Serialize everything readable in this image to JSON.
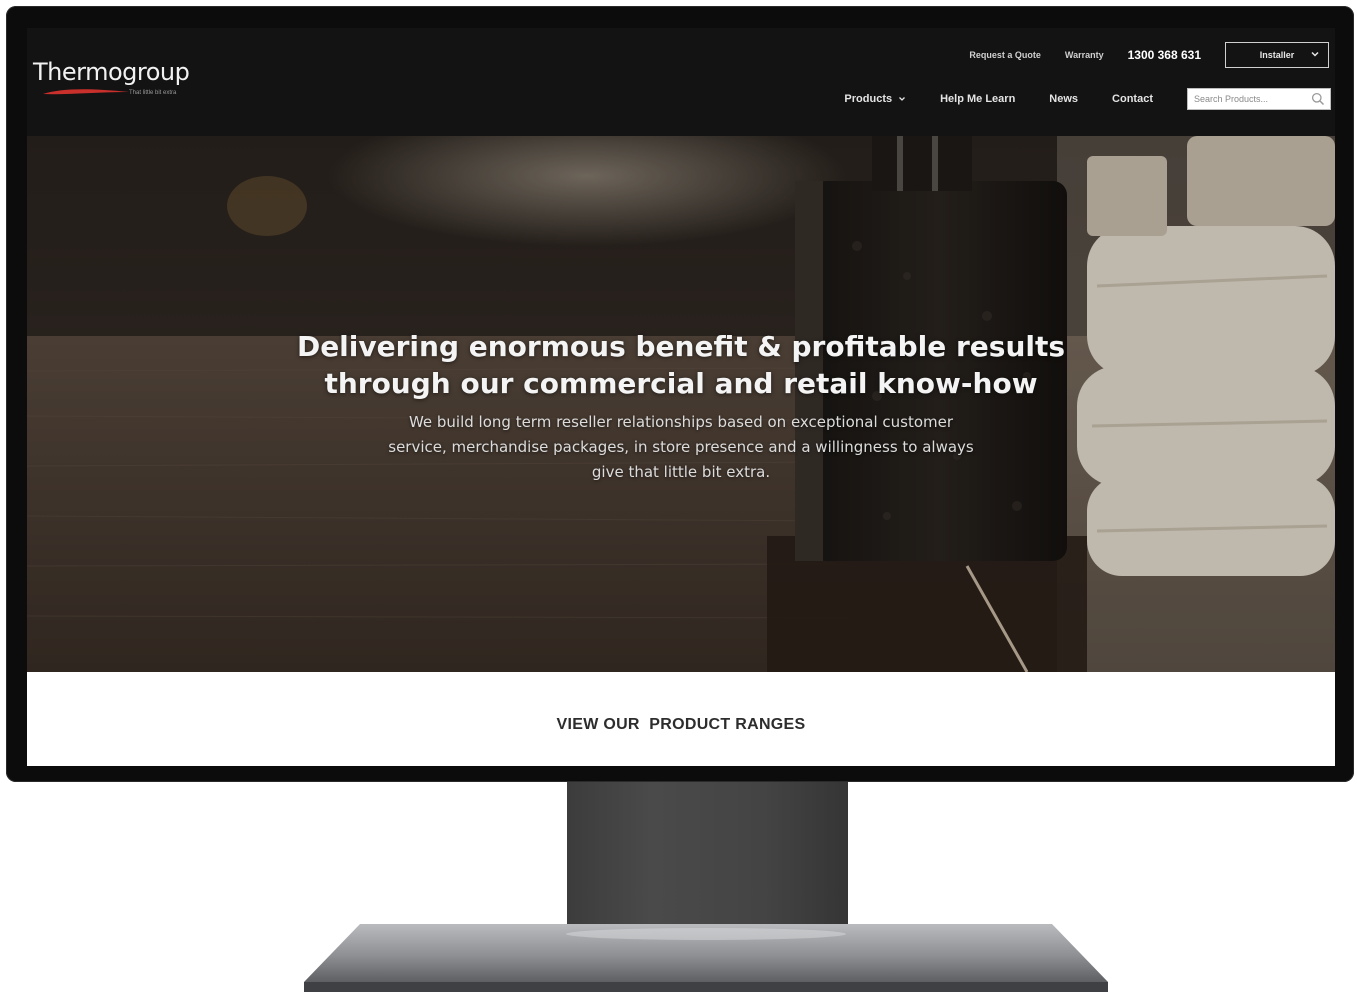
{
  "brand": {
    "logo_text": "Thermogroup",
    "tagline": "That little bit extra",
    "accent_color": "#c9302c"
  },
  "header": {
    "top_links": [
      "Request a Quote",
      "Warranty"
    ],
    "phone": "1300 368 631",
    "installer_select": {
      "selected": "Installer"
    },
    "nav": [
      {
        "label": "Products",
        "has_dropdown": true
      },
      {
        "label": "Help Me Learn",
        "has_dropdown": false
      },
      {
        "label": "News",
        "has_dropdown": false
      },
      {
        "label": "Contact",
        "has_dropdown": false
      }
    ],
    "search": {
      "placeholder": "Search Products..."
    }
  },
  "hero": {
    "heading_line1": "Delivering enormous benefit & profitable results",
    "heading_line2": "through our commercial and retail know-how",
    "subtext_line1": "We build long term reseller relationships based on exceptional customer",
    "subtext_line2": "service, merchandise packages, in store presence and a willingness to always",
    "subtext_line3": "give that little bit extra."
  },
  "section": {
    "title": "VIEW OUR  PRODUCT RANGES"
  }
}
